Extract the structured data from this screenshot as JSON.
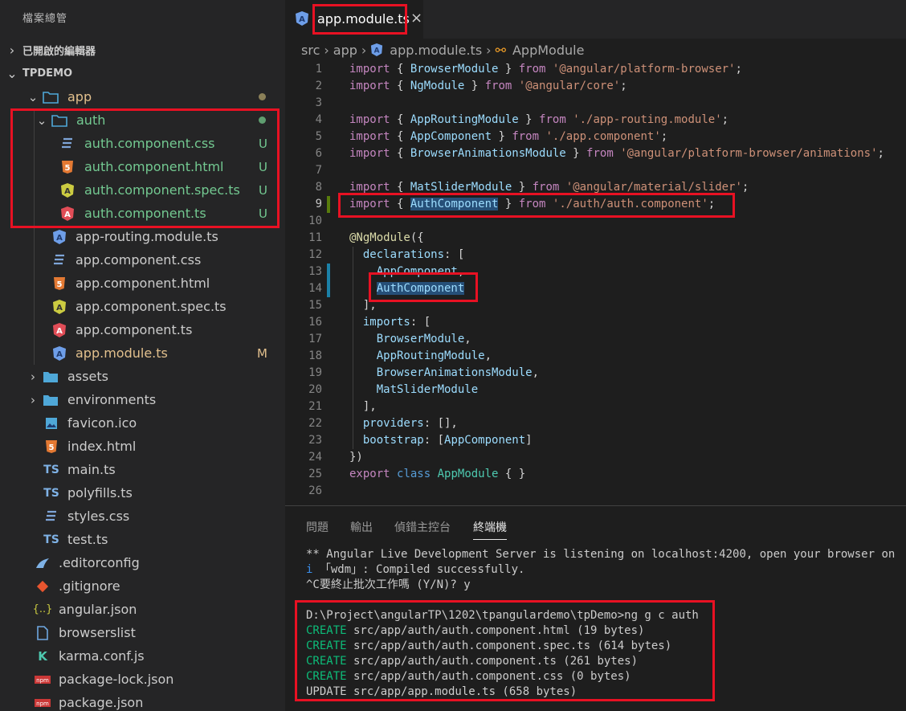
{
  "sidebar": {
    "title": "檔案總管",
    "open_editors": "已開啟的編輯器",
    "project": "TPDEMO"
  },
  "tree": [
    {
      "label": "app",
      "icon": "folder-open-icon",
      "status_dot": true
    },
    {
      "label": "auth",
      "icon": "folder-open-icon",
      "status_dot": true
    },
    {
      "label": "auth.component.css",
      "icon": "css-file-icon",
      "status": "U"
    },
    {
      "label": "auth.component.html",
      "icon": "html-file-icon",
      "status": "U"
    },
    {
      "label": "auth.component.spec.ts",
      "icon": "angular-spec-icon",
      "status": "U"
    },
    {
      "label": "auth.component.ts",
      "icon": "angular-component-icon",
      "status": "U"
    },
    {
      "label": "app-routing.module.ts",
      "icon": "angular-module-icon"
    },
    {
      "label": "app.component.css",
      "icon": "css-file-icon"
    },
    {
      "label": "app.component.html",
      "icon": "html-file-icon"
    },
    {
      "label": "app.component.spec.ts",
      "icon": "angular-spec-icon"
    },
    {
      "label": "app.component.ts",
      "icon": "angular-component-icon"
    },
    {
      "label": "app.module.ts",
      "icon": "angular-module-icon",
      "status": "M"
    },
    {
      "label": "assets",
      "icon": "folder-icon"
    },
    {
      "label": "environments",
      "icon": "folder-icon"
    },
    {
      "label": "favicon.ico",
      "icon": "image-file-icon"
    },
    {
      "label": "index.html",
      "icon": "html-file-icon"
    },
    {
      "label": "main.ts",
      "icon": "ts-file-icon"
    },
    {
      "label": "polyfills.ts",
      "icon": "ts-file-icon"
    },
    {
      "label": "styles.css",
      "icon": "css-file-icon"
    },
    {
      "label": "test.ts",
      "icon": "ts-file-icon"
    },
    {
      "label": ".editorconfig",
      "icon": "editorconfig-icon"
    },
    {
      "label": ".gitignore",
      "icon": "git-icon"
    },
    {
      "label": "angular.json",
      "icon": "json-file-icon"
    },
    {
      "label": "browserslist",
      "icon": "file-icon"
    },
    {
      "label": "karma.conf.js",
      "icon": "karma-icon"
    },
    {
      "label": "package-lock.json",
      "icon": "npm-icon"
    },
    {
      "label": "package.json",
      "icon": "npm-icon"
    }
  ],
  "tab": {
    "label": "app.module.ts",
    "close": "×"
  },
  "breadcrumb": [
    "src",
    "app",
    "app.module.ts",
    "AppModule"
  ],
  "code": [
    {
      "n": "1",
      "tokens": [
        [
          "kw",
          "import"
        ],
        [
          "pun",
          " { "
        ],
        [
          "id",
          "BrowserModule"
        ],
        [
          "pun",
          " } "
        ],
        [
          "kw",
          "from"
        ],
        [
          "pun",
          " "
        ],
        [
          "str",
          "'@angular/platform-browser'"
        ],
        [
          "pun",
          ";"
        ]
      ]
    },
    {
      "n": "2",
      "tokens": [
        [
          "kw",
          "import"
        ],
        [
          "pun",
          " { "
        ],
        [
          "id",
          "NgModule"
        ],
        [
          "pun",
          " } "
        ],
        [
          "kw",
          "from"
        ],
        [
          "pun",
          " "
        ],
        [
          "str",
          "'@angular/core'"
        ],
        [
          "pun",
          ";"
        ]
      ]
    },
    {
      "n": "3",
      "tokens": []
    },
    {
      "n": "4",
      "tokens": [
        [
          "kw",
          "import"
        ],
        [
          "pun",
          " { "
        ],
        [
          "id",
          "AppRoutingModule"
        ],
        [
          "pun",
          " } "
        ],
        [
          "kw",
          "from"
        ],
        [
          "pun",
          " "
        ],
        [
          "str",
          "'./app-routing.module'"
        ],
        [
          "pun",
          ";"
        ]
      ]
    },
    {
      "n": "5",
      "tokens": [
        [
          "kw",
          "import"
        ],
        [
          "pun",
          " { "
        ],
        [
          "id",
          "AppComponent"
        ],
        [
          "pun",
          " } "
        ],
        [
          "kw",
          "from"
        ],
        [
          "pun",
          " "
        ],
        [
          "str",
          "'./app.component'"
        ],
        [
          "pun",
          ";"
        ]
      ]
    },
    {
      "n": "6",
      "tokens": [
        [
          "kw",
          "import"
        ],
        [
          "pun",
          " { "
        ],
        [
          "id",
          "BrowserAnimationsModule"
        ],
        [
          "pun",
          " } "
        ],
        [
          "kw",
          "from"
        ],
        [
          "pun",
          " "
        ],
        [
          "str",
          "'@angular/platform-browser/animations'"
        ],
        [
          "pun",
          ";"
        ]
      ]
    },
    {
      "n": "7",
      "tokens": []
    },
    {
      "n": "8",
      "tokens": [
        [
          "kw",
          "import"
        ],
        [
          "pun",
          " { "
        ],
        [
          "id",
          "MatSliderModule"
        ],
        [
          "pun",
          " } "
        ],
        [
          "kw",
          "from"
        ],
        [
          "pun",
          " "
        ],
        [
          "str",
          "'@angular/material/slider'"
        ],
        [
          "pun",
          ";"
        ]
      ]
    },
    {
      "n": "9",
      "tokens": [
        [
          "kw",
          "import"
        ],
        [
          "pun",
          " { "
        ],
        [
          "idhl",
          "AuthComponent"
        ],
        [
          "pun",
          " } "
        ],
        [
          "kw",
          "from"
        ],
        [
          "pun",
          " "
        ],
        [
          "str",
          "'./auth/auth.component'"
        ],
        [
          "pun",
          ";"
        ]
      ]
    },
    {
      "n": "10",
      "tokens": []
    },
    {
      "n": "11",
      "tokens": [
        [
          "fn",
          "@NgModule"
        ],
        [
          "pun",
          "({"
        ]
      ]
    },
    {
      "n": "12",
      "tokens": [
        [
          "pun",
          "  "
        ],
        [
          "id",
          "declarations"
        ],
        [
          "pun",
          ": ["
        ]
      ]
    },
    {
      "n": "13",
      "tokens": [
        [
          "pun",
          "    "
        ],
        [
          "id",
          "AppComponent"
        ],
        [
          "pun",
          ","
        ]
      ]
    },
    {
      "n": "14",
      "tokens": [
        [
          "pun",
          "    "
        ],
        [
          "idhl",
          "AuthComponent"
        ]
      ]
    },
    {
      "n": "15",
      "tokens": [
        [
          "pun",
          "  ],"
        ]
      ]
    },
    {
      "n": "16",
      "tokens": [
        [
          "pun",
          "  "
        ],
        [
          "id",
          "imports"
        ],
        [
          "pun",
          ": ["
        ]
      ]
    },
    {
      "n": "17",
      "tokens": [
        [
          "pun",
          "    "
        ],
        [
          "id",
          "BrowserModule"
        ],
        [
          "pun",
          ","
        ]
      ]
    },
    {
      "n": "18",
      "tokens": [
        [
          "pun",
          "    "
        ],
        [
          "id",
          "AppRoutingModule"
        ],
        [
          "pun",
          ","
        ]
      ]
    },
    {
      "n": "19",
      "tokens": [
        [
          "pun",
          "    "
        ],
        [
          "id",
          "BrowserAnimationsModule"
        ],
        [
          "pun",
          ","
        ]
      ]
    },
    {
      "n": "20",
      "tokens": [
        [
          "pun",
          "    "
        ],
        [
          "id",
          "MatSliderModule"
        ]
      ]
    },
    {
      "n": "21",
      "tokens": [
        [
          "pun",
          "  ],"
        ]
      ]
    },
    {
      "n": "22",
      "tokens": [
        [
          "pun",
          "  "
        ],
        [
          "id",
          "providers"
        ],
        [
          "pun",
          ": [],"
        ]
      ]
    },
    {
      "n": "23",
      "tokens": [
        [
          "pun",
          "  "
        ],
        [
          "id",
          "bootstrap"
        ],
        [
          "pun",
          ": ["
        ],
        [
          "id",
          "AppComponent"
        ],
        [
          "pun",
          "]"
        ]
      ]
    },
    {
      "n": "24",
      "tokens": [
        [
          "pun",
          "})"
        ]
      ]
    },
    {
      "n": "25",
      "tokens": [
        [
          "kw",
          "export"
        ],
        [
          "pun",
          " "
        ],
        [
          "kw2",
          "class"
        ],
        [
          "pun",
          " "
        ],
        [
          "cls",
          "AppModule"
        ],
        [
          "pun",
          " { }"
        ]
      ]
    },
    {
      "n": "26",
      "tokens": []
    }
  ],
  "panel": {
    "tabs": [
      "問題",
      "輸出",
      "偵錯主控台",
      "終端機"
    ],
    "terminal": [
      [
        [
          "t",
          "** Angular Live Development Server is listening on localhost:4200, open your browser on"
        ]
      ],
      [
        [
          "b",
          "i"
        ],
        [
          "t",
          " 「wdm」: Compiled successfully."
        ]
      ],
      [
        [
          "t",
          "^C要終止批次工作嗎 (Y/N)? y"
        ]
      ],
      [
        [
          "t",
          ""
        ]
      ],
      [
        [
          "t",
          "D:\\Project\\angularTP\\1202\\tpangulardemo\\tpDemo>ng g c auth"
        ]
      ],
      [
        [
          "g",
          "CREATE"
        ],
        [
          "t",
          " src/app/auth/auth.component.html (19 bytes)"
        ]
      ],
      [
        [
          "g",
          "CREATE"
        ],
        [
          "t",
          " src/app/auth/auth.component.spec.ts (614 bytes)"
        ]
      ],
      [
        [
          "g",
          "CREATE"
        ],
        [
          "t",
          " src/app/auth/auth.component.ts (261 bytes)"
        ]
      ],
      [
        [
          "g",
          "CREATE"
        ],
        [
          "t",
          " src/app/auth/auth.component.css (0 bytes)"
        ]
      ],
      [
        [
          "t",
          "UPDATE src/app/app.module.ts (658 bytes)"
        ]
      ]
    ]
  },
  "colors": {
    "accent_red": "#e81123",
    "untracked_green": "#73c991",
    "modified_gold": "#e2c08d"
  }
}
